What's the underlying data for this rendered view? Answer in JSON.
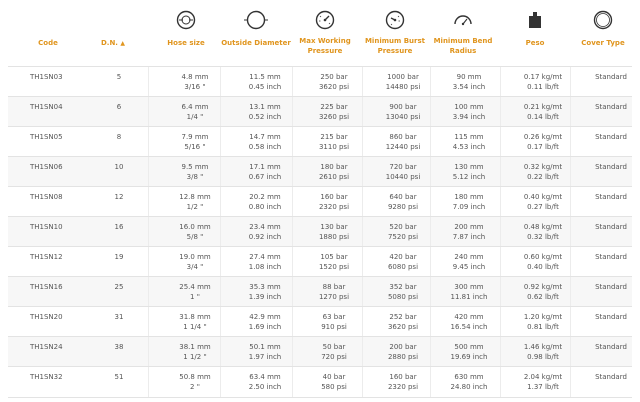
{
  "header": {
    "code": "Code",
    "dn": "D.N.",
    "hose_size": "Hose size",
    "outside_diameter": "Outside Diameter",
    "max_working_pressure": [
      "Max Working",
      "Pressure"
    ],
    "min_burst_pressure": [
      "Minimum Burst",
      "Pressure"
    ],
    "min_bend_radius": [
      "Minimum Bend",
      "Radius"
    ],
    "peso": "Peso",
    "cover_type": "Cover Type",
    "icons": [
      "hose-size-icon",
      "outside-diameter-icon",
      "pressure-gauge-icon",
      "burst-gauge-icon",
      "bend-radius-icon",
      "weight-icon",
      "cover-ring-icon"
    ],
    "accent_color": "#e0951e"
  },
  "rows": [
    {
      "code": "TH1SN03",
      "dn": "5",
      "hs": [
        "4.8 mm",
        "3/16 \""
      ],
      "od": [
        "11.5 mm",
        "0.45 inch"
      ],
      "wp": [
        "250 bar",
        "3620 psi"
      ],
      "bp": [
        "1000 bar",
        "14480 psi"
      ],
      "br": [
        "90 mm",
        "3.54 inch"
      ],
      "pe": [
        "0.17 kg/mt",
        "0.11 lb/ft"
      ],
      "ct": "Standard"
    },
    {
      "code": "TH1SN04",
      "dn": "6",
      "hs": [
        "6.4 mm",
        "1/4 \""
      ],
      "od": [
        "13.1 mm",
        "0.52 inch"
      ],
      "wp": [
        "225 bar",
        "3260 psi"
      ],
      "bp": [
        "900 bar",
        "13040 psi"
      ],
      "br": [
        "100 mm",
        "3.94 inch"
      ],
      "pe": [
        "0.21 kg/mt",
        "0.14 lb/ft"
      ],
      "ct": "Standard"
    },
    {
      "code": "TH1SN05",
      "dn": "8",
      "hs": [
        "7.9 mm",
        "5/16 \""
      ],
      "od": [
        "14.7 mm",
        "0.58 inch"
      ],
      "wp": [
        "215 bar",
        "3110 psi"
      ],
      "bp": [
        "860 bar",
        "12440 psi"
      ],
      "br": [
        "115 mm",
        "4.53 inch"
      ],
      "pe": [
        "0.26 kg/mt",
        "0.17 lb/ft"
      ],
      "ct": "Standard"
    },
    {
      "code": "TH1SN06",
      "dn": "10",
      "hs": [
        "9.5 mm",
        "3/8 \""
      ],
      "od": [
        "17.1 mm",
        "0.67 inch"
      ],
      "wp": [
        "180 bar",
        "2610 psi"
      ],
      "bp": [
        "720 bar",
        "10440 psi"
      ],
      "br": [
        "130 mm",
        "5.12 inch"
      ],
      "pe": [
        "0.32 kg/mt",
        "0.22 lb/ft"
      ],
      "ct": "Standard"
    },
    {
      "code": "TH1SN08",
      "dn": "12",
      "hs": [
        "12.8 mm",
        "1/2 \""
      ],
      "od": [
        "20.2 mm",
        "0.80 inch"
      ],
      "wp": [
        "160 bar",
        "2320 psi"
      ],
      "bp": [
        "640 bar",
        "9280 psi"
      ],
      "br": [
        "180 mm",
        "7.09 inch"
      ],
      "pe": [
        "0.40 kg/mt",
        "0.27 lb/ft"
      ],
      "ct": "Standard"
    },
    {
      "code": "TH1SN10",
      "dn": "16",
      "hs": [
        "16.0 mm",
        "5/8 \""
      ],
      "od": [
        "23.4 mm",
        "0.92 inch"
      ],
      "wp": [
        "130 bar",
        "1880 psi"
      ],
      "bp": [
        "520 bar",
        "7520 psi"
      ],
      "br": [
        "200 mm",
        "7.87 inch"
      ],
      "pe": [
        "0.48 kg/mt",
        "0.32 lb/ft"
      ],
      "ct": "Standard"
    },
    {
      "code": "TH1SN12",
      "dn": "19",
      "hs": [
        "19.0 mm",
        "3/4 \""
      ],
      "od": [
        "27.4 mm",
        "1.08 inch"
      ],
      "wp": [
        "105 bar",
        "1520 psi"
      ],
      "bp": [
        "420 bar",
        "6080 psi"
      ],
      "br": [
        "240 mm",
        "9.45 inch"
      ],
      "pe": [
        "0.60 kg/mt",
        "0.40 lb/ft"
      ],
      "ct": "Standard"
    },
    {
      "code": "TH1SN16",
      "dn": "25",
      "hs": [
        "25.4 mm",
        "1 \""
      ],
      "od": [
        "35.3 mm",
        "1.39 inch"
      ],
      "wp": [
        "88 bar",
        "1270 psi"
      ],
      "bp": [
        "352 bar",
        "5080 psi"
      ],
      "br": [
        "300 mm",
        "11.81 inch"
      ],
      "pe": [
        "0.92 kg/mt",
        "0.62 lb/ft"
      ],
      "ct": "Standard"
    },
    {
      "code": "TH1SN20",
      "dn": "31",
      "hs": [
        "31.8 mm",
        "1 1/4 \""
      ],
      "od": [
        "42.9 mm",
        "1.69 inch"
      ],
      "wp": [
        "63 bar",
        "910 psi"
      ],
      "bp": [
        "252 bar",
        "3620 psi"
      ],
      "br": [
        "420 mm",
        "16.54 inch"
      ],
      "pe": [
        "1.20 kg/mt",
        "0.81 lb/ft"
      ],
      "ct": "Standard"
    },
    {
      "code": "TH1SN24",
      "dn": "38",
      "hs": [
        "38.1 mm",
        "1 1/2 \""
      ],
      "od": [
        "50.1 mm",
        "1.97 inch"
      ],
      "wp": [
        "50 bar",
        "720 psi"
      ],
      "bp": [
        "200 bar",
        "2880 psi"
      ],
      "br": [
        "500 mm",
        "19.69 inch"
      ],
      "pe": [
        "1.46 kg/mt",
        "0.98 lb/ft"
      ],
      "ct": "Standard"
    },
    {
      "code": "TH1SN32",
      "dn": "51",
      "hs": [
        "50.8 mm",
        "2 \""
      ],
      "od": [
        "63.4 mm",
        "2.50 inch"
      ],
      "wp": [
        "40 bar",
        "580 psi"
      ],
      "bp": [
        "160 bar",
        "2320 psi"
      ],
      "br": [
        "630 mm",
        "24.80 inch"
      ],
      "pe": [
        "2.04 kg/mt",
        "1.37 lb/ft"
      ],
      "ct": "Standard"
    }
  ]
}
